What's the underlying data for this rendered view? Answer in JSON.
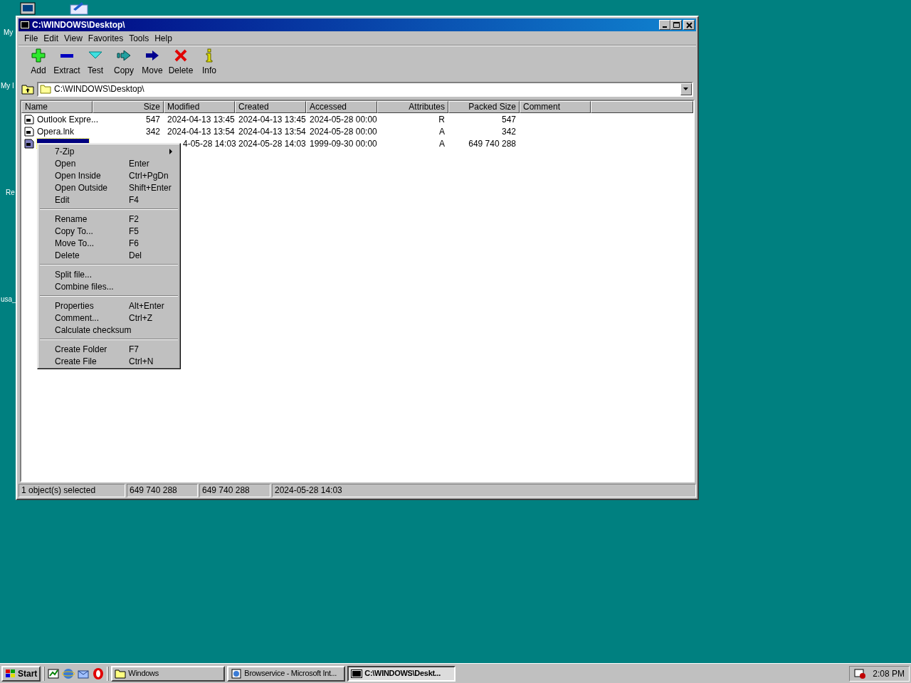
{
  "desktop_labels": [
    "My",
    "My I",
    "Re",
    "usa_"
  ],
  "window": {
    "title": "C:\\WINDOWS\\Desktop\\",
    "menu": [
      "File",
      "Edit",
      "View",
      "Favorites",
      "Tools",
      "Help"
    ],
    "toolbar": [
      {
        "kind": "add",
        "label": "Add"
      },
      {
        "kind": "extract",
        "label": "Extract"
      },
      {
        "kind": "test",
        "label": "Test"
      },
      {
        "kind": "copy",
        "label": "Copy"
      },
      {
        "kind": "move",
        "label": "Move"
      },
      {
        "kind": "delete",
        "label": "Delete"
      },
      {
        "kind": "info",
        "label": "Info"
      }
    ],
    "address": "C:\\WINDOWS\\Desktop\\",
    "columns": [
      "Name",
      "Size",
      "Modified",
      "Created",
      "Accessed",
      "Attributes",
      "Packed Size",
      "Comment"
    ],
    "rows": [
      {
        "selected": false,
        "cells": [
          "Outlook Expre...",
          "547",
          "2024-04-13 13:45",
          "2024-04-13 13:45",
          "2024-05-28 00:00",
          "R",
          "547",
          null
        ]
      },
      {
        "selected": false,
        "cells": [
          "Opera.lnk",
          "342",
          "2024-04-13 13:54",
          "2024-04-13 13:54",
          "2024-05-28 00:00",
          "A",
          "342",
          null
        ]
      },
      {
        "selected": true,
        "cells": [
          null,
          null,
          "4-05-28 14:03",
          "2024-05-28 14:03",
          "1999-09-30 00:00",
          "A",
          "649 740 288",
          null
        ]
      }
    ],
    "status": [
      "1 object(s) selected",
      "649 740 288",
      "649 740 288",
      "2024-05-28 14:03"
    ]
  },
  "context_menu": [
    [
      {
        "label": "7-Zip",
        "submenu": true
      },
      {
        "label": "Open",
        "shortcut": "Enter",
        "submenu": false
      },
      {
        "label": "Open Inside",
        "shortcut": "Ctrl+PgDn",
        "submenu": false
      },
      {
        "label": "Open Outside",
        "shortcut": "Shift+Enter",
        "submenu": false
      },
      {
        "label": "Edit",
        "shortcut": "F4",
        "submenu": false
      }
    ],
    [
      {
        "label": "Rename",
        "shortcut": "F2",
        "submenu": false
      },
      {
        "label": "Copy To...",
        "shortcut": "F5",
        "submenu": false
      },
      {
        "label": "Move To...",
        "shortcut": "F6",
        "submenu": false
      },
      {
        "label": "Delete",
        "shortcut": "Del",
        "submenu": false
      }
    ],
    [
      {
        "label": "Split file...",
        "submenu": false
      },
      {
        "label": "Combine files...",
        "submenu": false
      }
    ],
    [
      {
        "label": "Properties",
        "shortcut": "Alt+Enter",
        "submenu": false
      },
      {
        "label": "Comment...",
        "shortcut": "Ctrl+Z",
        "submenu": false
      },
      {
        "label": "Calculate checksum",
        "submenu": false
      }
    ],
    [
      {
        "label": "Create Folder",
        "shortcut": "F7",
        "submenu": false
      },
      {
        "label": "Create File",
        "shortcut": "Ctrl+N",
        "submenu": false
      }
    ]
  ],
  "taskbar": {
    "start": "Start",
    "tasks": [
      {
        "kind": "folder",
        "label": "Windows",
        "selected": false
      },
      {
        "kind": "browser",
        "label": "Browservice - Microsoft Int...",
        "selected": false
      },
      {
        "kind": "sevenzip",
        "label": "C:\\WINDOWS\\Deskt...",
        "selected": true
      }
    ],
    "clock": "2:08 PM"
  }
}
